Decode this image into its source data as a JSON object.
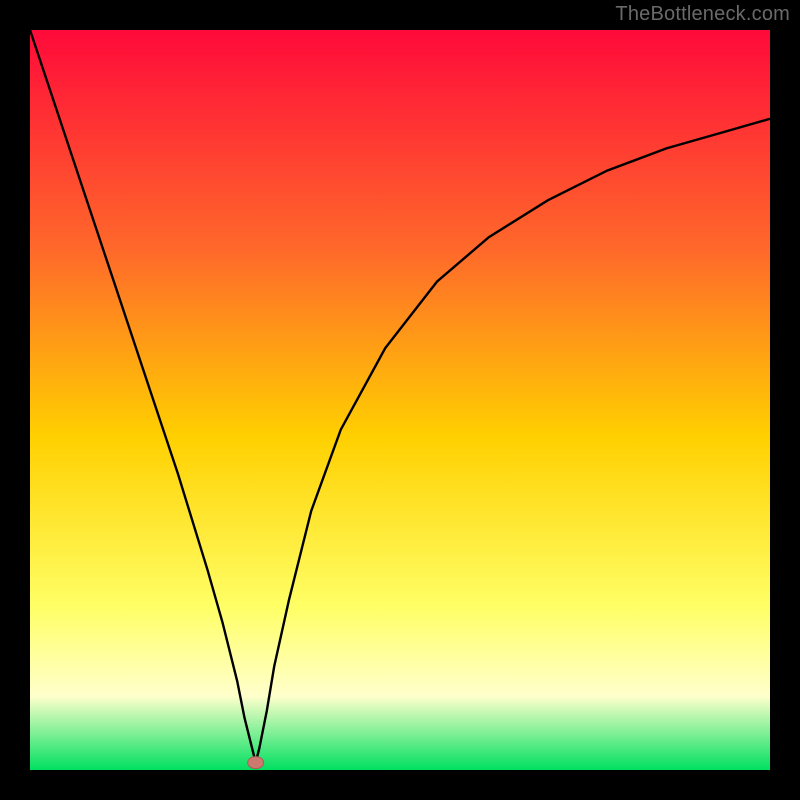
{
  "watermark": "TheBottleneck.com",
  "colors": {
    "frame": "#000000",
    "gradient_top": "#ff0a3a",
    "gradient_upper_mid": "#ff6a2a",
    "gradient_mid": "#ffd000",
    "gradient_lower_mid": "#ffff66",
    "gradient_pale": "#ffffcc",
    "gradient_bottom": "#00e060",
    "curve": "#000000",
    "marker_fill": "#cc7a70",
    "marker_stroke": "#a85e55"
  },
  "chart_data": {
    "type": "line",
    "title": "",
    "xlabel": "",
    "ylabel": "",
    "xlim": [
      0,
      100
    ],
    "ylim": [
      0,
      100
    ],
    "curve": {
      "x": [
        0,
        4,
        8,
        12,
        16,
        20,
        24,
        26,
        28,
        29,
        30,
        30.5,
        31,
        32,
        33,
        35,
        38,
        42,
        48,
        55,
        62,
        70,
        78,
        86,
        93,
        100
      ],
      "y": [
        100,
        88,
        76,
        64,
        52,
        40,
        27,
        20,
        12,
        7,
        3,
        1,
        3,
        8,
        14,
        23,
        35,
        46,
        57,
        66,
        72,
        77,
        81,
        84,
        86,
        88
      ]
    },
    "marker": {
      "x": 30.5,
      "y": 1
    },
    "gradient_axis": "vertical"
  }
}
